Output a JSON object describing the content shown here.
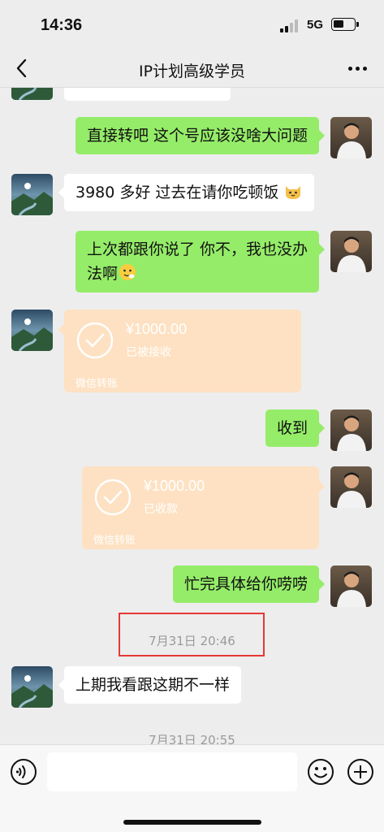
{
  "status_bar": {
    "time": "14:36",
    "network": "5G"
  },
  "header": {
    "title": "IP计划高级学员",
    "back_icon": "chevron-left-icon",
    "more_icon": "more-dots-icon"
  },
  "messages": [
    {
      "sender": "me",
      "type": "text",
      "text": "直接转吧 这个号应该没啥大问题"
    },
    {
      "sender": "other",
      "type": "text",
      "text": "3980 多好 过去在请你吃顿饭",
      "emoji": "cat-face-emoji"
    },
    {
      "sender": "me",
      "type": "text",
      "text_line1": "上次都跟你说了 你不，我也没办",
      "text_line2": "法啊",
      "emoji": "sweat-smile-emoji"
    },
    {
      "sender": "other",
      "type": "transfer",
      "amount": "¥1000.00",
      "status": "已被接收",
      "brand": "微信转账"
    },
    {
      "sender": "me",
      "type": "text",
      "text": "收到"
    },
    {
      "sender": "me",
      "type": "transfer",
      "amount": "¥1000.00",
      "status": "已收款",
      "brand": "微信转账"
    },
    {
      "sender": "me",
      "type": "text",
      "text": "忙完具体给你唠唠"
    },
    {
      "type": "timestamp",
      "text": "7月31日 20:46"
    },
    {
      "sender": "other",
      "type": "text",
      "text": "上期我看跟这期不一样"
    },
    {
      "type": "timestamp",
      "text": "7月31日 20:55"
    }
  ],
  "input_bar": {
    "placeholder": "",
    "voice_icon": "voice-icon",
    "emoji_icon": "emoji-icon",
    "plus_icon": "plus-icon"
  },
  "colors": {
    "background": "#ededed",
    "green_bubble": "#95ec69",
    "transfer_bubble": "#fde1c2",
    "highlight": "#e53935"
  }
}
